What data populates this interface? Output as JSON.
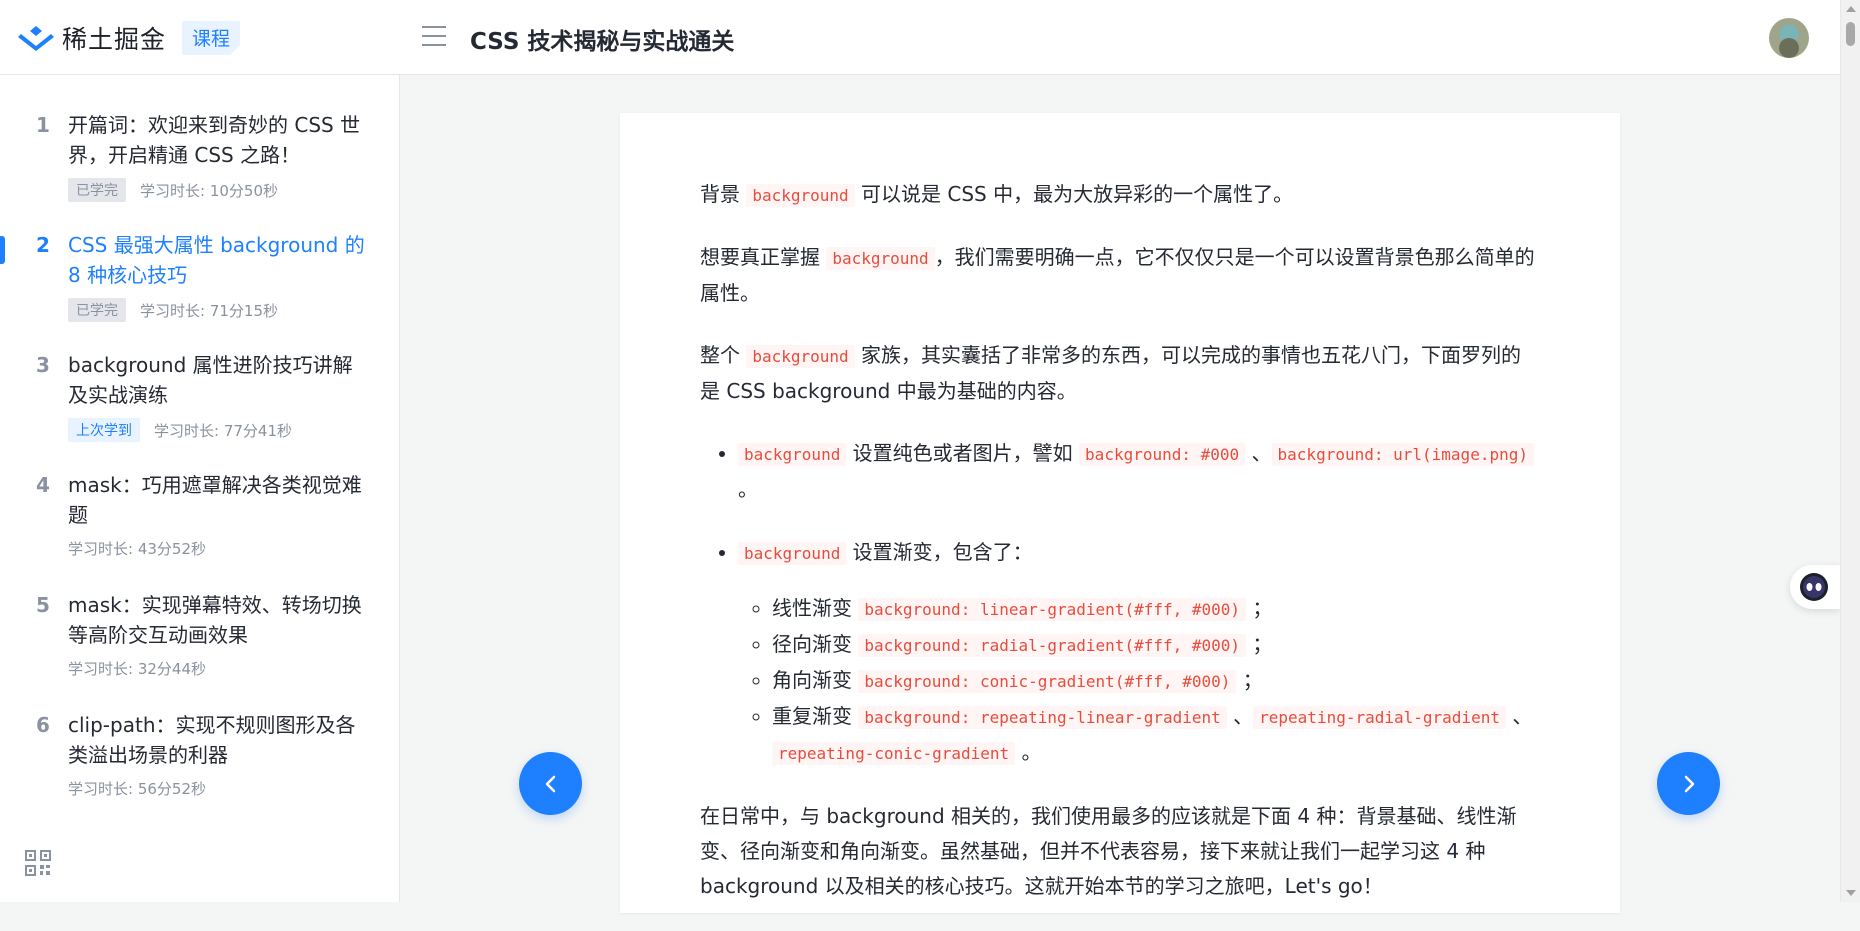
{
  "header": {
    "logo_text": "稀土掘金",
    "course_tag": "课程",
    "book_title": "CSS 技术揭秘与实战通关"
  },
  "sidebar": {
    "sections": [
      {
        "num": "1",
        "title": "开篇词：欢迎来到奇妙的 CSS 世界，开启精通 CSS 之路！",
        "badge": "已学完",
        "duration": "学习时长: 10分50秒"
      },
      {
        "num": "2",
        "title": "CSS 最强大属性 background 的 8 种核心技巧",
        "badge": "已学完",
        "duration": "学习时长: 71分15秒"
      },
      {
        "num": "3",
        "title": "background 属性进阶技巧讲解及实战演练",
        "badge": "上次学到",
        "duration": "学习时长: 77分41秒"
      },
      {
        "num": "4",
        "title": "mask：巧用遮罩解决各类视觉难题",
        "duration": "学习时长: 43分52秒"
      },
      {
        "num": "5",
        "title": "mask：实现弹幕特效、转场切换等高阶交互动画效果",
        "duration": "学习时长: 32分44秒"
      },
      {
        "num": "6",
        "title": "clip-path：实现不规则图形及各类溢出场景的利器",
        "duration": "学习时长: 56分52秒"
      }
    ]
  },
  "article": {
    "p1_pre": "背景 ",
    "p1_code": "background",
    "p1_post": " 可以说是 CSS 中，最为大放异彩的一个属性了。",
    "p2_pre": "想要真正掌握 ",
    "p2_code": "background",
    "p2_post": "，我们需要明确一点，它不仅仅只是一个可以设置背景色那么简单的属性。",
    "p3_pre": "整个 ",
    "p3_code": "background",
    "p3_post": " 家族，其实囊括了非常多的东西，可以完成的事情也五花八门，下面罗列的是 CSS background 中最为基础的内容。",
    "li1_code": "background",
    "li1_text": " 设置纯色或者图片，譬如 ",
    "li1_code2": "background: #000",
    "li1_sep": " 、",
    "li1_code3": "background: url(image.png)",
    "li1_end": " 。",
    "li2_code": "background",
    "li2_text": " 设置渐变，包含了：",
    "sub": [
      {
        "label": "线性渐变 ",
        "code": "background: linear-gradient(#fff, #000)",
        "end": " ；"
      },
      {
        "label": "径向渐变 ",
        "code": "background: radial-gradient(#fff, #000)",
        "end": " ；"
      },
      {
        "label": "角向渐变 ",
        "code": "background: conic-gradient(#fff, #000)",
        "end": " ；"
      }
    ],
    "sub4_label": "重复渐变 ",
    "sub4_code1": "background: repeating-linear-gradient",
    "sub4_sep1": " 、",
    "sub4_code2": "repeating-radial-gradient",
    "sub4_sep2": " 、",
    "sub4_code3": "repeating-conic-gradient",
    "sub4_end": " 。",
    "p4": "在日常中，与 background 相关的，我们使用最多的应该就是下面 4 种：背景基础、线性渐变、径向渐变和角向渐变。虽然基础，但并不代表容易，接下来就让我们一起学习这 4 种 background 以及相关的核心技巧。这就开始本节的学习之旅吧，Let's go！"
  },
  "colors": {
    "accent": "#1e80ff",
    "code_red": "#e74c3c"
  }
}
